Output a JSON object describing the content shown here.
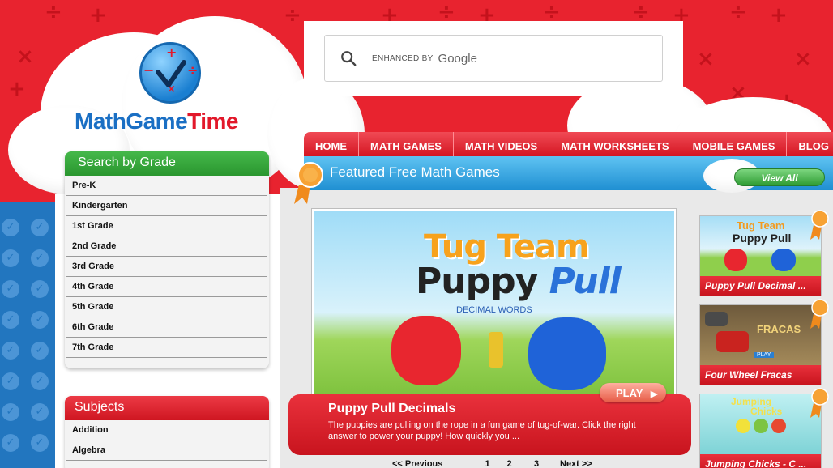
{
  "logo": {
    "part1": "MathGame",
    "part2": "Time"
  },
  "search": {
    "enhanced_by": "ENHANCED BY",
    "google": "Google"
  },
  "nav": {
    "items": [
      "HOME",
      "MATH GAMES",
      "MATH VIDEOS",
      "MATH WORKSHEETS",
      "MOBILE GAMES",
      "BLOG"
    ]
  },
  "grade_panel": {
    "title": "Search by Grade",
    "items": [
      "Pre-K",
      "Kindergarten",
      "1st Grade",
      "2nd Grade",
      "3rd Grade",
      "4th Grade",
      "5th Grade",
      "6th Grade",
      "7th Grade"
    ]
  },
  "subjects_panel": {
    "title": "Subjects",
    "items": [
      "Addition",
      "Algebra"
    ]
  },
  "featured": {
    "title": "Featured Free Math Games",
    "view_all": "View All",
    "main_game": {
      "art_title_line1": "Tug Team",
      "art_title_puppy": "Puppy",
      "art_title_pull": "Pull",
      "art_subtitle": "DECIMAL WORDS",
      "play_label": "PLAY",
      "name": "Puppy Pull Decimals",
      "description": "The puppies are pulling on the rope in a fun game of tug-of-war. Click the right answer to power your puppy! How quickly you ..."
    },
    "pager": {
      "prev": "<< Previous",
      "pages": [
        "1",
        "2",
        "3"
      ],
      "next": "Next >>"
    },
    "side_games": [
      {
        "caption": "Puppy Pull Decimal ...",
        "art_line1": "Tug Team",
        "art_line2": "Puppy Pull"
      },
      {
        "caption": "Four Wheel Fracas",
        "art_line1": "FRACAS",
        "art_line2": "PLAY"
      },
      {
        "caption": "Jumping Chicks - C ...",
        "art_line1": "Jumping",
        "art_line2": "Chicks"
      }
    ]
  },
  "colors": {
    "brand_red": "#e8232f",
    "brand_blue": "#1a6fc4",
    "nav_red": "#d41622",
    "featured_blue": "#1f8fd2",
    "panel_green": "#2a962f"
  }
}
